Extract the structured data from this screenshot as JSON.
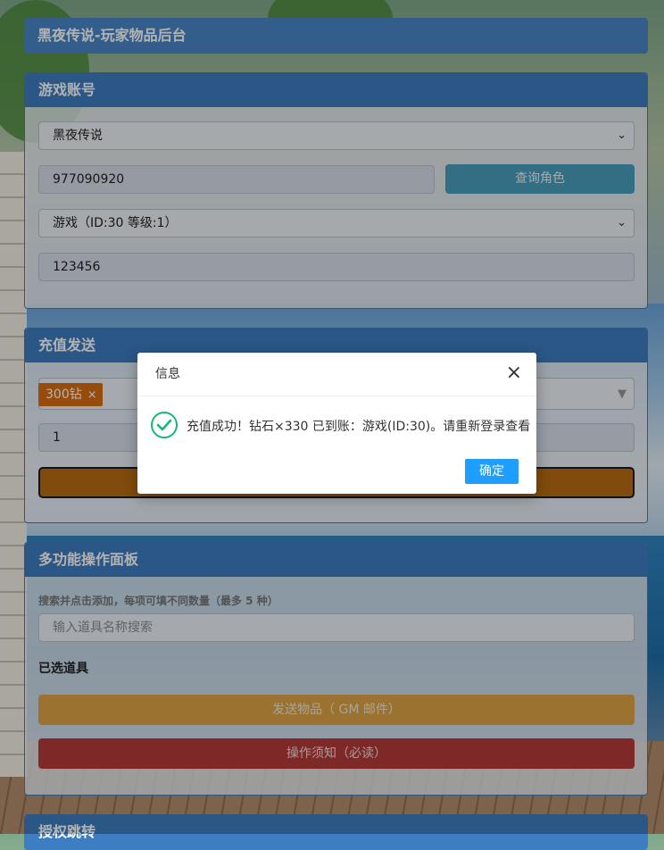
{
  "header": {
    "title": "黑夜传说-玩家物品后台"
  },
  "account_panel": {
    "title": "游戏账号",
    "server_select": "黑夜传说",
    "account_value": "977090920",
    "query_button": "查询角色",
    "role_select": "游戏（ID:30 等级:1）",
    "password_value": "123456"
  },
  "recharge_panel": {
    "title": "充值发送",
    "selected_tag": "300钻",
    "tag_remove": "×",
    "quantity_value": "1"
  },
  "multi_panel": {
    "title": "多功能操作面板",
    "hint": "搜索并点击添加，每项可填不同数量（最多 5 种）",
    "search_placeholder": "输入道具名称搜索",
    "selected_items_title": "已选道具",
    "send_button": "发送物品（ GM 邮件）",
    "notice_button": "操作须知（必读）"
  },
  "auth_panel": {
    "title": "授权跳转"
  },
  "dialog": {
    "title": "信息",
    "close": "×",
    "message": "充值成功！钻石×330 已到账：游戏(ID:30)。请重新登录查看",
    "ok_button": "确定"
  },
  "colors": {
    "accent": "#3d7dc1",
    "success": "#16b777",
    "ok_button": "#1e9fff"
  }
}
